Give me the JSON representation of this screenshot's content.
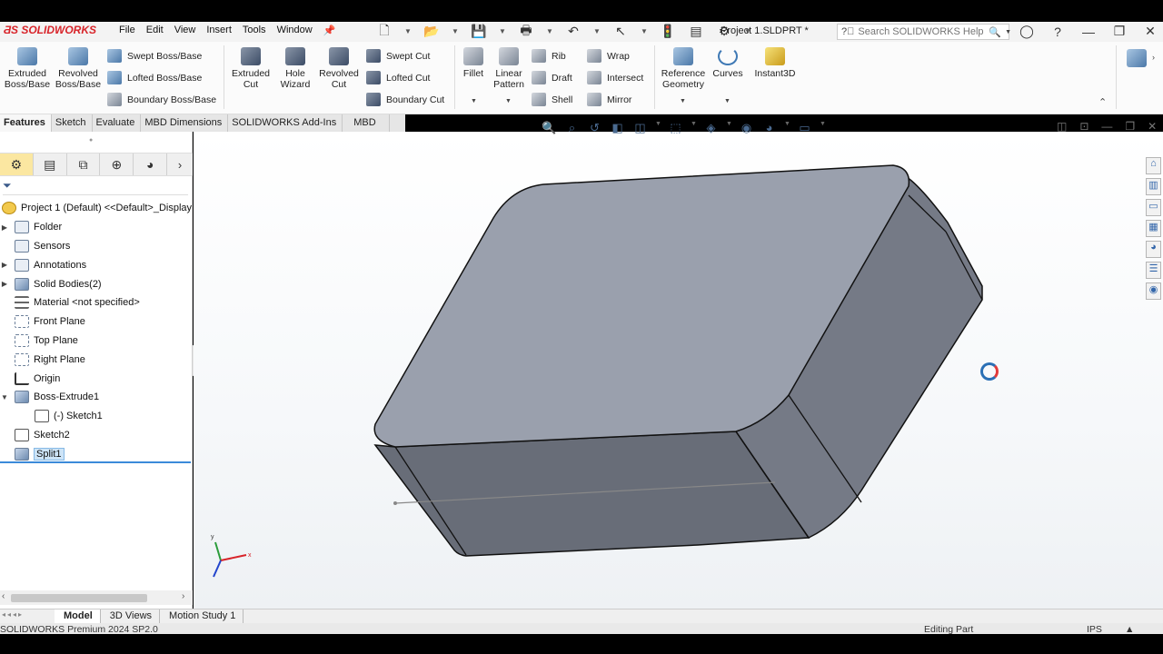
{
  "app": {
    "logo": "SOLIDWORKS",
    "menus": [
      "File",
      "Edit",
      "View",
      "Insert",
      "Tools",
      "Window"
    ],
    "document_title": "Project 1.SLDPRT *",
    "search_placeholder": "Search SOLIDWORKS Help"
  },
  "ribbon": {
    "extruded_boss": "Extruded Boss/Base",
    "revolved_boss": "Revolved Boss/Base",
    "swept_boss": "Swept Boss/Base",
    "lofted_boss": "Lofted Boss/Base",
    "boundary_boss": "Boundary Boss/Base",
    "extruded_cut": "Extruded Cut",
    "hole_wizard": "Hole Wizard",
    "revolved_cut": "Revolved Cut",
    "swept_cut": "Swept Cut",
    "lofted_cut": "Lofted Cut",
    "boundary_cut": "Boundary Cut",
    "fillet": "Fillet",
    "linear_pattern": "Linear Pattern",
    "rib": "Rib",
    "draft": "Draft",
    "shell": "Shell",
    "wrap": "Wrap",
    "intersect": "Intersect",
    "mirror": "Mirror",
    "reference_geometry": "Reference Geometry",
    "curves": "Curves",
    "instant3d": "Instant3D"
  },
  "tabs": [
    "Features",
    "Sketch",
    "Evaluate",
    "MBD Dimensions",
    "SOLIDWORKS Add-Ins",
    "MBD"
  ],
  "tree": {
    "root": "Project 1 (Default) <<Default>_Display",
    "items": [
      {
        "label": "Folder",
        "expandable": true
      },
      {
        "label": "Sensors",
        "expandable": false
      },
      {
        "label": "Annotations",
        "expandable": true
      },
      {
        "label": "Solid Bodies(2)",
        "expandable": true
      },
      {
        "label": "Material <not specified>",
        "expandable": false
      },
      {
        "label": "Front Plane",
        "expandable": false
      },
      {
        "label": "Top Plane",
        "expandable": false
      },
      {
        "label": "Right Plane",
        "expandable": false
      },
      {
        "label": "Origin",
        "expandable": false
      },
      {
        "label": "Boss-Extrude1",
        "expandable": true
      },
      {
        "label": "(-) Sketch1",
        "expandable": false
      },
      {
        "label": "Sketch2",
        "expandable": false
      },
      {
        "label": "Split1",
        "expandable": false
      }
    ]
  },
  "bottom_tabs": [
    "Model",
    "3D Views",
    "Motion Study 1"
  ],
  "status": {
    "version": "SOLIDWORKS Premium 2024 SP2.0",
    "mode": "Editing Part",
    "units": "IPS"
  },
  "colors": {
    "accent": "#3b8ad9",
    "model_top": "#9aa0ad",
    "model_side": "#6f7480"
  }
}
